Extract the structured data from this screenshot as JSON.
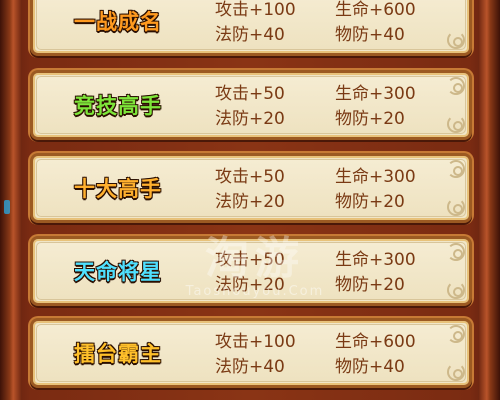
{
  "rows": [
    {
      "title": "一战成名",
      "stats": [
        "攻击+100",
        "生命+600",
        "法防+40",
        "物防+40"
      ]
    },
    {
      "title": "竞技高手",
      "stats": [
        "攻击+50",
        "生命+300",
        "法防+20",
        "物防+20"
      ]
    },
    {
      "title": "十大高手",
      "stats": [
        "攻击+50",
        "生命+300",
        "法防+20",
        "物防+20"
      ]
    },
    {
      "title": "天命将星",
      "stats": [
        "攻击+50",
        "生命+300",
        "法防+20",
        "物防+20"
      ]
    },
    {
      "title": "擂台霸主",
      "stats": [
        "攻击+100",
        "生命+600",
        "法防+40",
        "物防+40"
      ]
    }
  ],
  "watermark": {
    "logo": "淘游",
    "domain": "Taoshouyou.Com"
  },
  "colors": {
    "title_row1": "#ff9a1f",
    "title_row2": "#7ee63a",
    "title_row3": "#ffb02e",
    "title_row4": "#4fe0ff",
    "title_row5": "#ffc02a",
    "stat_text": "#7a3a14",
    "panel_bg": "#f0e6c8"
  }
}
